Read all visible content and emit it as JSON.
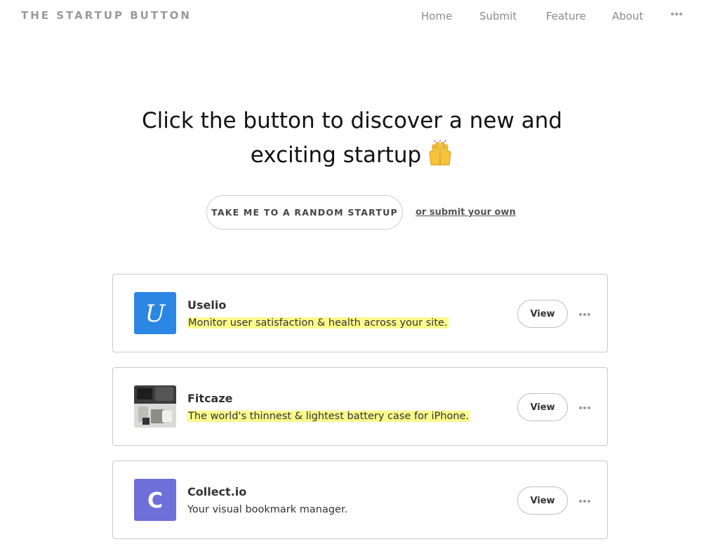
{
  "header": {
    "logo": "THE STARTUP BUTTON",
    "nav": [
      {
        "label": "Home"
      },
      {
        "label": "Submit"
      },
      {
        "label": "Feature"
      },
      {
        "label": "About"
      }
    ],
    "more_icon": "ellipsis-icon"
  },
  "hero": {
    "line1": "Click the button to discover a new and",
    "line2": "exciting startup",
    "emoji": "raising-hands-emoji"
  },
  "actions": {
    "random_label": "TAKE ME TO A RANDOM STARTUP",
    "submit_link": "or submit your own"
  },
  "startups": [
    {
      "name": "Uselio",
      "tagline": "Monitor user satisfaction & health across your site.",
      "highlighted": true,
      "logo_letter": "U",
      "logo_color": "#2b86e4",
      "view_label": "View"
    },
    {
      "name": "Fitcaze",
      "tagline": "The world's thinnest & lightest battery case for iPhone.",
      "highlighted": true,
      "logo_letter": "",
      "logo_color": "#3a3a3a",
      "view_label": "View"
    },
    {
      "name": "Collect.io",
      "tagline": "Your visual bookmark manager.",
      "highlighted": false,
      "logo_letter": "C",
      "logo_color": "#6e6fd8",
      "view_label": "View"
    }
  ],
  "colors": {
    "highlight": "#fcfa8c",
    "muted_text": "#8a8a8a",
    "border": "#c9c9c9"
  }
}
